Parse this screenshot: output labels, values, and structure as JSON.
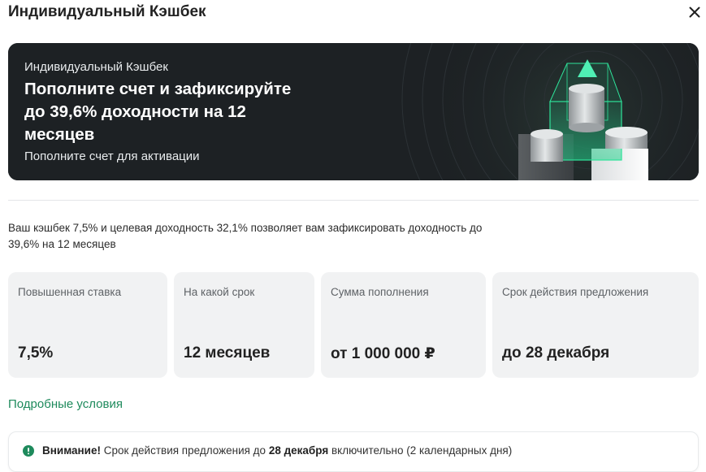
{
  "dialog": {
    "title": "Индивидуальный Кэшбек",
    "close_icon": "close-icon"
  },
  "banner": {
    "eyebrow": "Индивидуальный Кэшбек",
    "headline": "Пополните счет и зафиксируйте до 39,6% доходности на 12 месяцев",
    "subtitle": "Пополните счет для активации",
    "accent_color": "#21a86a",
    "background_color": "#1d2124"
  },
  "description": "Ваш кэшбек 7,5% и целевая доходность 32,1% позволяет вам зафиксировать доходность до 39,6% на 12 месяцев",
  "cards": [
    {
      "label": "Повышенная ставка",
      "value": "7,5%"
    },
    {
      "label": "На какой срок",
      "value": "12 месяцев"
    },
    {
      "label": "Сумма пополнения",
      "value": "от 1 000 000 ₽"
    },
    {
      "label": "Срок действия предложения",
      "value": "до 28 декабря"
    }
  ],
  "details_link": "Подробные условия",
  "notice": {
    "icon": "alert-icon",
    "prefix": "Внимание!",
    "text_1": " Срок действия предложения до ",
    "date": "28 декабря",
    "text_2": " включительно (2 календарных дня)",
    "icon_color": "#1e8a5c"
  }
}
